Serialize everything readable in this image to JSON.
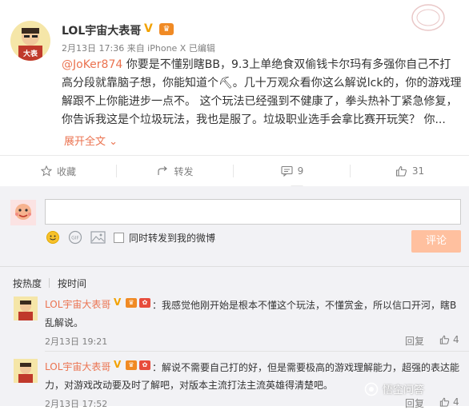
{
  "post": {
    "username": "LOL宇宙大表哥",
    "v_badge": "V",
    "meta": "2月13日 17:36 来自 iPhone X  已编辑",
    "mention": "@JoKer874",
    "content_text": " 你要是不懂别瞎BB，9.3上单绝食双偷钱卡尔玛有多强你自己不打高分段就靠脑子想，你能知道个⛏。几十万观众看你这么解说lck的，你的游戏理解跟不上你能进步一点不。 这个玩法已经强到不健康了，拳头热补丁紧急修复，你告诉我这是个垃圾玩法，我也是服了。垃圾职业选手会拿比赛开玩笑？ 你...",
    "expand_label": "展开全文 ⌄"
  },
  "actions": {
    "favorite_label": "收藏",
    "forward_label": "转发",
    "comment_count": "9",
    "like_count": "31"
  },
  "comment_box": {
    "forward_also_label": "同时转发到我的微博",
    "submit_label": "评论"
  },
  "sort": {
    "by_hot": "按热度",
    "by_time": "按时间"
  },
  "comments": [
    {
      "name": "LOL宇宙大表哥",
      "text": "：我感觉他刚开始是根本不懂这个玩法，不懂赏金，所以信口开河，瞎B乱解说。",
      "time": "2月13日 19:21",
      "reply_label": "回复",
      "likes": "4"
    },
    {
      "name": "LOL宇宙大表哥",
      "text": "：解说不需要自己打的好，但是需要极高的游戏理解能力，超强的表达能力，对游戏改动要及时了解吧，对版本主流打法主流英雄得清楚吧。",
      "time": "2月13日 17:52",
      "reply_label": "回复",
      "likes": "4"
    }
  ],
  "watermark": "悟空问答",
  "colors": {
    "accent": "#eb7350",
    "submit_bg": "#ffc09f",
    "comments_bg": "#f2f2f5",
    "vip_badge": "#f08a24"
  }
}
